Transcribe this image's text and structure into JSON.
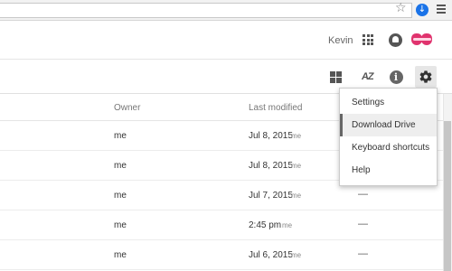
{
  "browser": {
    "bookmark_icon": "star-outline-icon",
    "extension_icon": "download-arrow-icon",
    "menu_icon": "hamburger-menu-icon"
  },
  "header": {
    "user_name": "Kevin",
    "apps_icon": "apps-grid-icon",
    "notifications_icon": "bell-icon",
    "avatar_icon": "lips-avatar"
  },
  "toolbar": {
    "grid_view_icon": "grid-view-icon",
    "sort_label": "AZ",
    "info_label": "i",
    "settings_icon": "gear-icon"
  },
  "table": {
    "columns": [
      "Owner",
      "Last modified"
    ],
    "rows": [
      {
        "owner": "me",
        "modified": "Jul 8, 2015",
        "by": "me",
        "size": ""
      },
      {
        "owner": "me",
        "modified": "Jul 8, 2015",
        "by": "me",
        "size": ""
      },
      {
        "owner": "me",
        "modified": "Jul 7, 2015",
        "by": "me",
        "size": "—"
      },
      {
        "owner": "me",
        "modified": "2:45 pm",
        "by": "me",
        "size": "—"
      },
      {
        "owner": "me",
        "modified": "Jul 6, 2015",
        "by": "me",
        "size": "—"
      }
    ]
  },
  "settings_menu": {
    "items": [
      {
        "label": "Settings"
      },
      {
        "label": "Download Drive"
      },
      {
        "label": "Keyboard shortcuts"
      },
      {
        "label": "Help"
      }
    ],
    "highlighted_index": 1
  },
  "colors": {
    "accent_blue": "#1a73e8",
    "avatar_pink": "#e0336e"
  }
}
